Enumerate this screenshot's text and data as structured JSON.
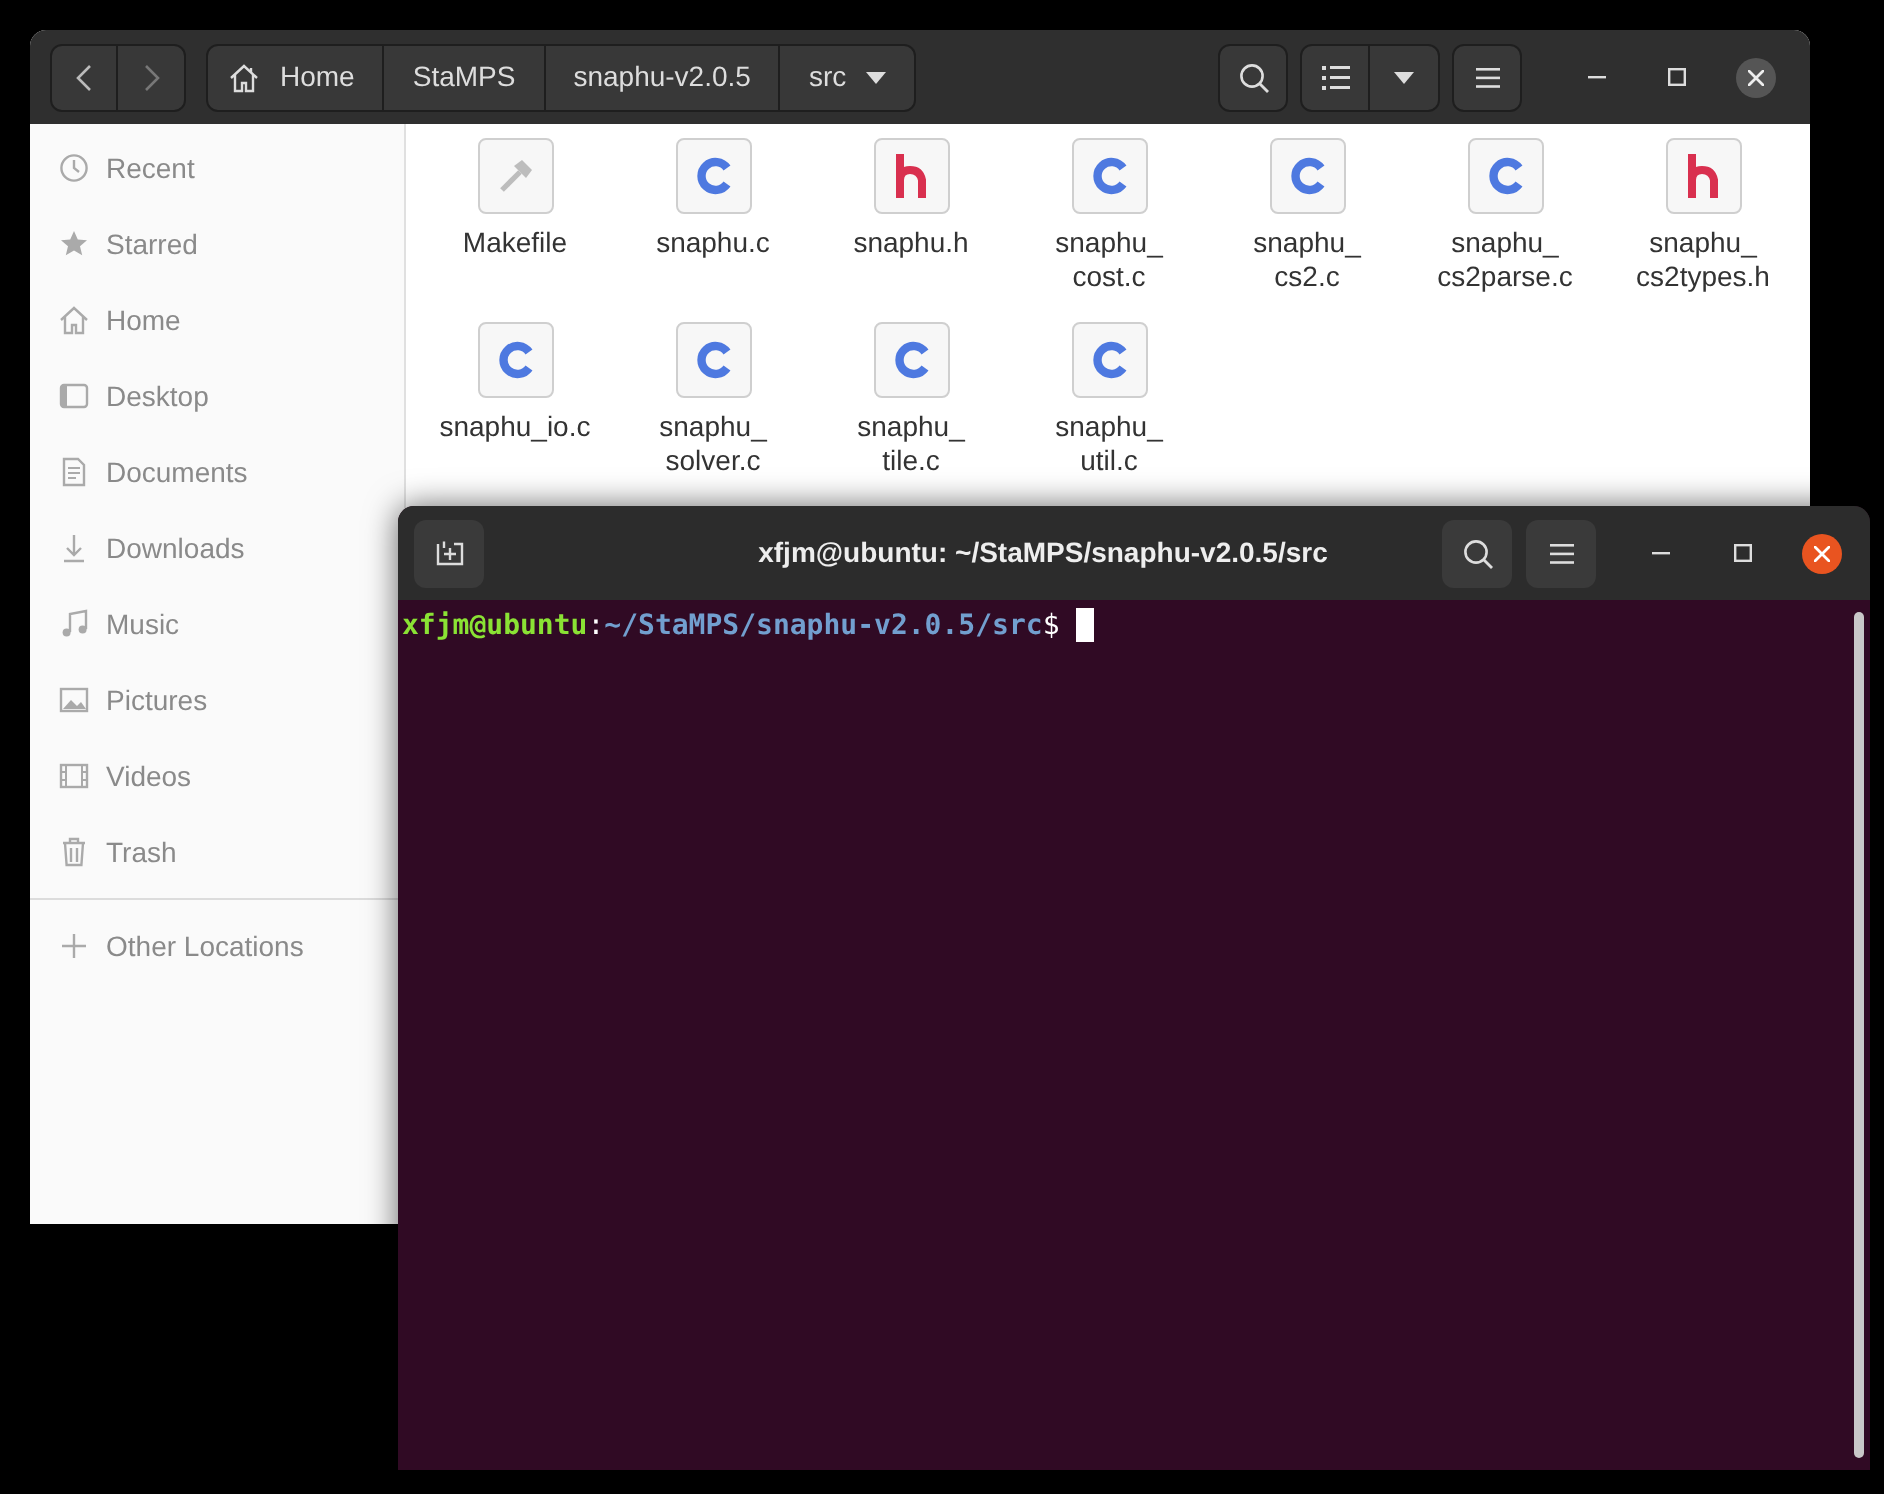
{
  "file_manager": {
    "path": [
      {
        "label": "Home",
        "kind": "home"
      },
      {
        "label": "StaMPS",
        "kind": "folder"
      },
      {
        "label": "snaphu-v2.0.5",
        "kind": "folder"
      },
      {
        "label": "src",
        "kind": "current"
      }
    ],
    "sidebar": {
      "items": [
        {
          "label": "Recent",
          "kind": "recent"
        },
        {
          "label": "Starred",
          "kind": "starred"
        },
        {
          "label": "Home",
          "kind": "home"
        },
        {
          "label": "Desktop",
          "kind": "desktop"
        },
        {
          "label": "Documents",
          "kind": "documents"
        },
        {
          "label": "Downloads",
          "kind": "downloads"
        },
        {
          "label": "Music",
          "kind": "music"
        },
        {
          "label": "Pictures",
          "kind": "pictures"
        },
        {
          "label": "Videos",
          "kind": "videos"
        },
        {
          "label": "Trash",
          "kind": "trash"
        }
      ],
      "other": {
        "label": "Other Locations",
        "kind": "other"
      }
    },
    "files": [
      {
        "name": "Makefile",
        "kind": "make"
      },
      {
        "name": "snaphu.c",
        "kind": "c"
      },
      {
        "name": "snaphu.h",
        "kind": "h"
      },
      {
        "name": "snaphu_\ncost.c",
        "kind": "c"
      },
      {
        "name": "snaphu_\ncs2.c",
        "kind": "c"
      },
      {
        "name": "snaphu_\ncs2parse.c",
        "kind": "c"
      },
      {
        "name": "snaphu_\ncs2types.h",
        "kind": "h"
      },
      {
        "name": "snaphu_io.c",
        "kind": "c"
      },
      {
        "name": "snaphu_\nsolver.c",
        "kind": "c"
      },
      {
        "name": "snaphu_\ntile.c",
        "kind": "c"
      },
      {
        "name": "snaphu_\nutil.c",
        "kind": "c"
      }
    ]
  },
  "terminal": {
    "title": "xfjm@ubuntu: ~/StaMPS/snaphu-v2.0.5/src",
    "prompt": {
      "user": "xfjm@ubuntu",
      "separator": ":",
      "path": "~/StaMPS/snaphu-v2.0.5/src",
      "symbol": "$"
    }
  }
}
